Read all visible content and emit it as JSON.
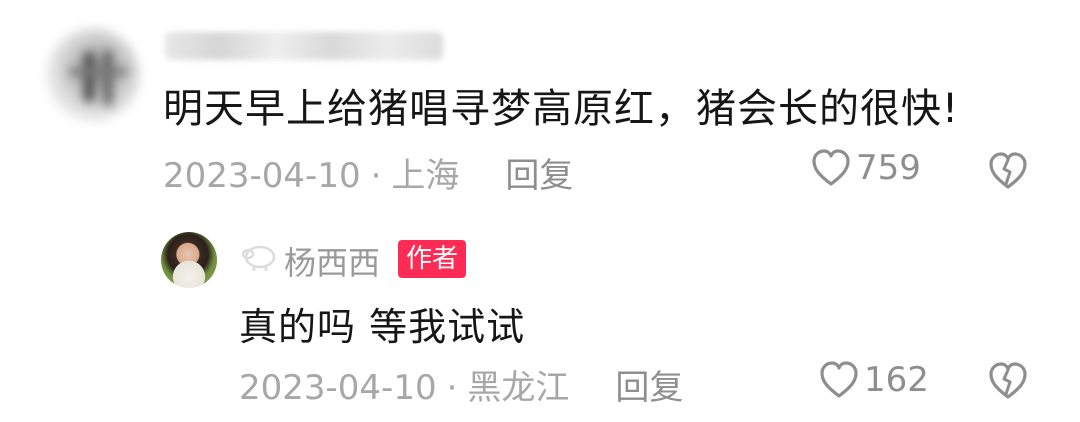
{
  "comment": {
    "text": "明天早上给猪唱寻梦高原红，猪会长的很快!",
    "date": "2023-04-10",
    "separator": "·",
    "location": "上海",
    "reply_label": "回复",
    "likes": "759"
  },
  "reply": {
    "author": "杨西西",
    "badge": "作者",
    "text": "真的吗 等我试试",
    "date": "2023-04-10",
    "separator": "·",
    "location": "黑龙江",
    "reply_label": "回复",
    "likes": "162"
  },
  "icons": {
    "like": "heart-outline-icon",
    "dislike": "broken-heart-icon",
    "sheep": "sheep-icon"
  },
  "colors": {
    "badge_bg": "#fe2c55",
    "text": "#161616",
    "meta": "#a7a7a7"
  }
}
